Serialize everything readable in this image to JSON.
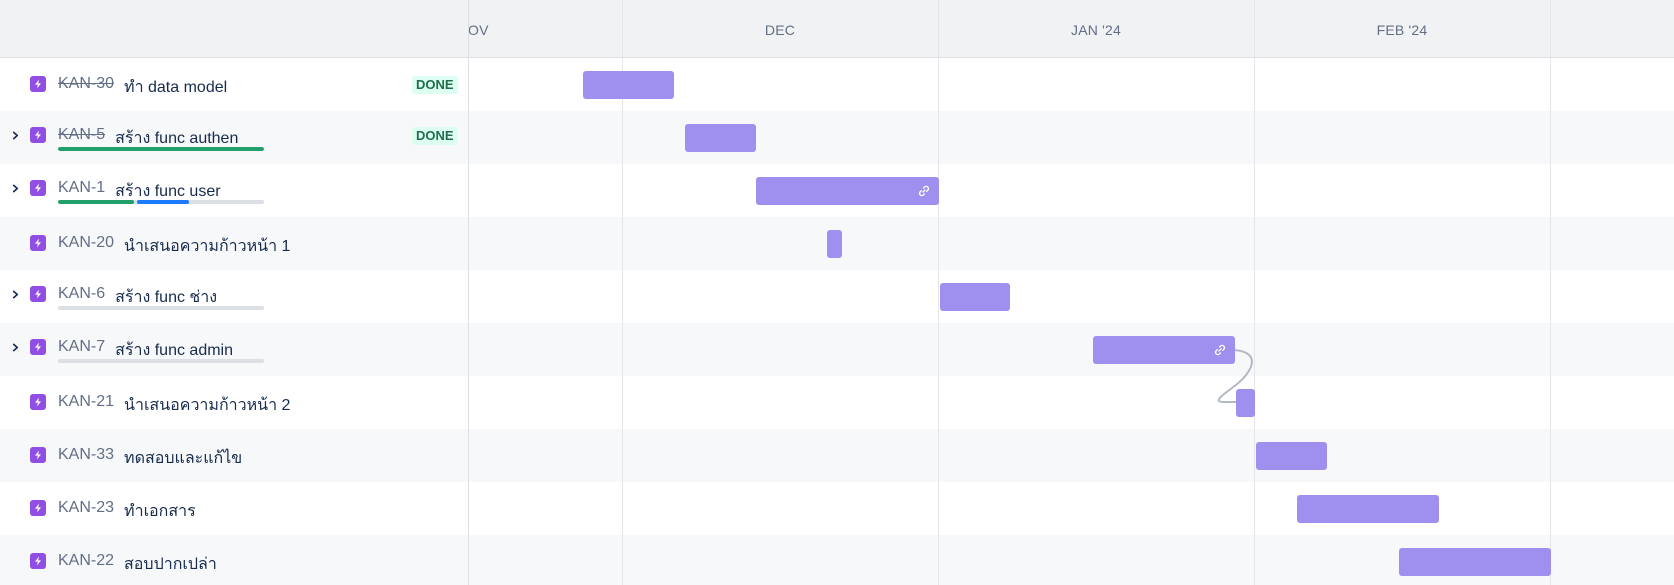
{
  "timeline": {
    "months": [
      {
        "label": "OV",
        "name": "month-nov"
      },
      {
        "label": "DEC",
        "name": "month-dec"
      },
      {
        "label": "JAN '24",
        "name": "month-jan"
      },
      {
        "label": "FEB '24",
        "name": "month-feb"
      }
    ]
  },
  "issues": [
    {
      "key": "KAN-30",
      "summary": "ทำ data model",
      "status": "DONE",
      "done": true,
      "expandable": false,
      "type_icon": "epic-lightning-icon"
    },
    {
      "key": "KAN-5",
      "summary": "สร้าง func authen",
      "status": "DONE",
      "done": true,
      "expandable": true,
      "progress": {
        "done": 1.0,
        "in_progress": 0.0
      },
      "type_icon": "epic-lightning-icon"
    },
    {
      "key": "KAN-1",
      "summary": "สร้าง func user",
      "status": "",
      "done": false,
      "expandable": true,
      "progress": {
        "done": 0.37,
        "in_progress": 0.25
      },
      "bar_link": true,
      "type_icon": "epic-lightning-icon"
    },
    {
      "key": "KAN-20",
      "summary": "นำเสนอความก้าวหน้า 1",
      "status": "",
      "done": false,
      "expandable": false,
      "type_icon": "epic-lightning-icon"
    },
    {
      "key": "KAN-6",
      "summary": "สร้าง func ช่าง",
      "status": "",
      "done": false,
      "expandable": true,
      "progress": {
        "done": 0.0,
        "in_progress": 0.0
      },
      "type_icon": "epic-lightning-icon"
    },
    {
      "key": "KAN-7",
      "summary": "สร้าง func admin",
      "status": "",
      "done": false,
      "expandable": true,
      "progress": {
        "done": 0.0,
        "in_progress": 0.0
      },
      "bar_link": true,
      "type_icon": "epic-lightning-icon"
    },
    {
      "key": "KAN-21",
      "summary": "นำเสนอความก้าวหน้า 2",
      "status": "",
      "done": false,
      "expandable": false,
      "type_icon": "epic-lightning-icon"
    },
    {
      "key": "KAN-33",
      "summary": "ทดสอบและแก้ไข",
      "status": "",
      "done": false,
      "expandable": false,
      "type_icon": "epic-lightning-icon"
    },
    {
      "key": "KAN-23",
      "summary": "ทำเอกสาร",
      "status": "",
      "done": false,
      "expandable": false,
      "type_icon": "epic-lightning-icon"
    },
    {
      "key": "KAN-22",
      "summary": "สอบปากเปล่า",
      "status": "",
      "done": false,
      "expandable": false,
      "type_icon": "epic-lightning-icon"
    }
  ],
  "colors": {
    "bar": "#9f8fef",
    "epic_icon": "#904ee2",
    "progress_done": "#22a06b",
    "progress_in_progress": "#1d7afc",
    "progress_track": "#dcdfe4",
    "done_lozenge_text": "#216e4e",
    "done_lozenge_bg": "#dcfff1"
  }
}
